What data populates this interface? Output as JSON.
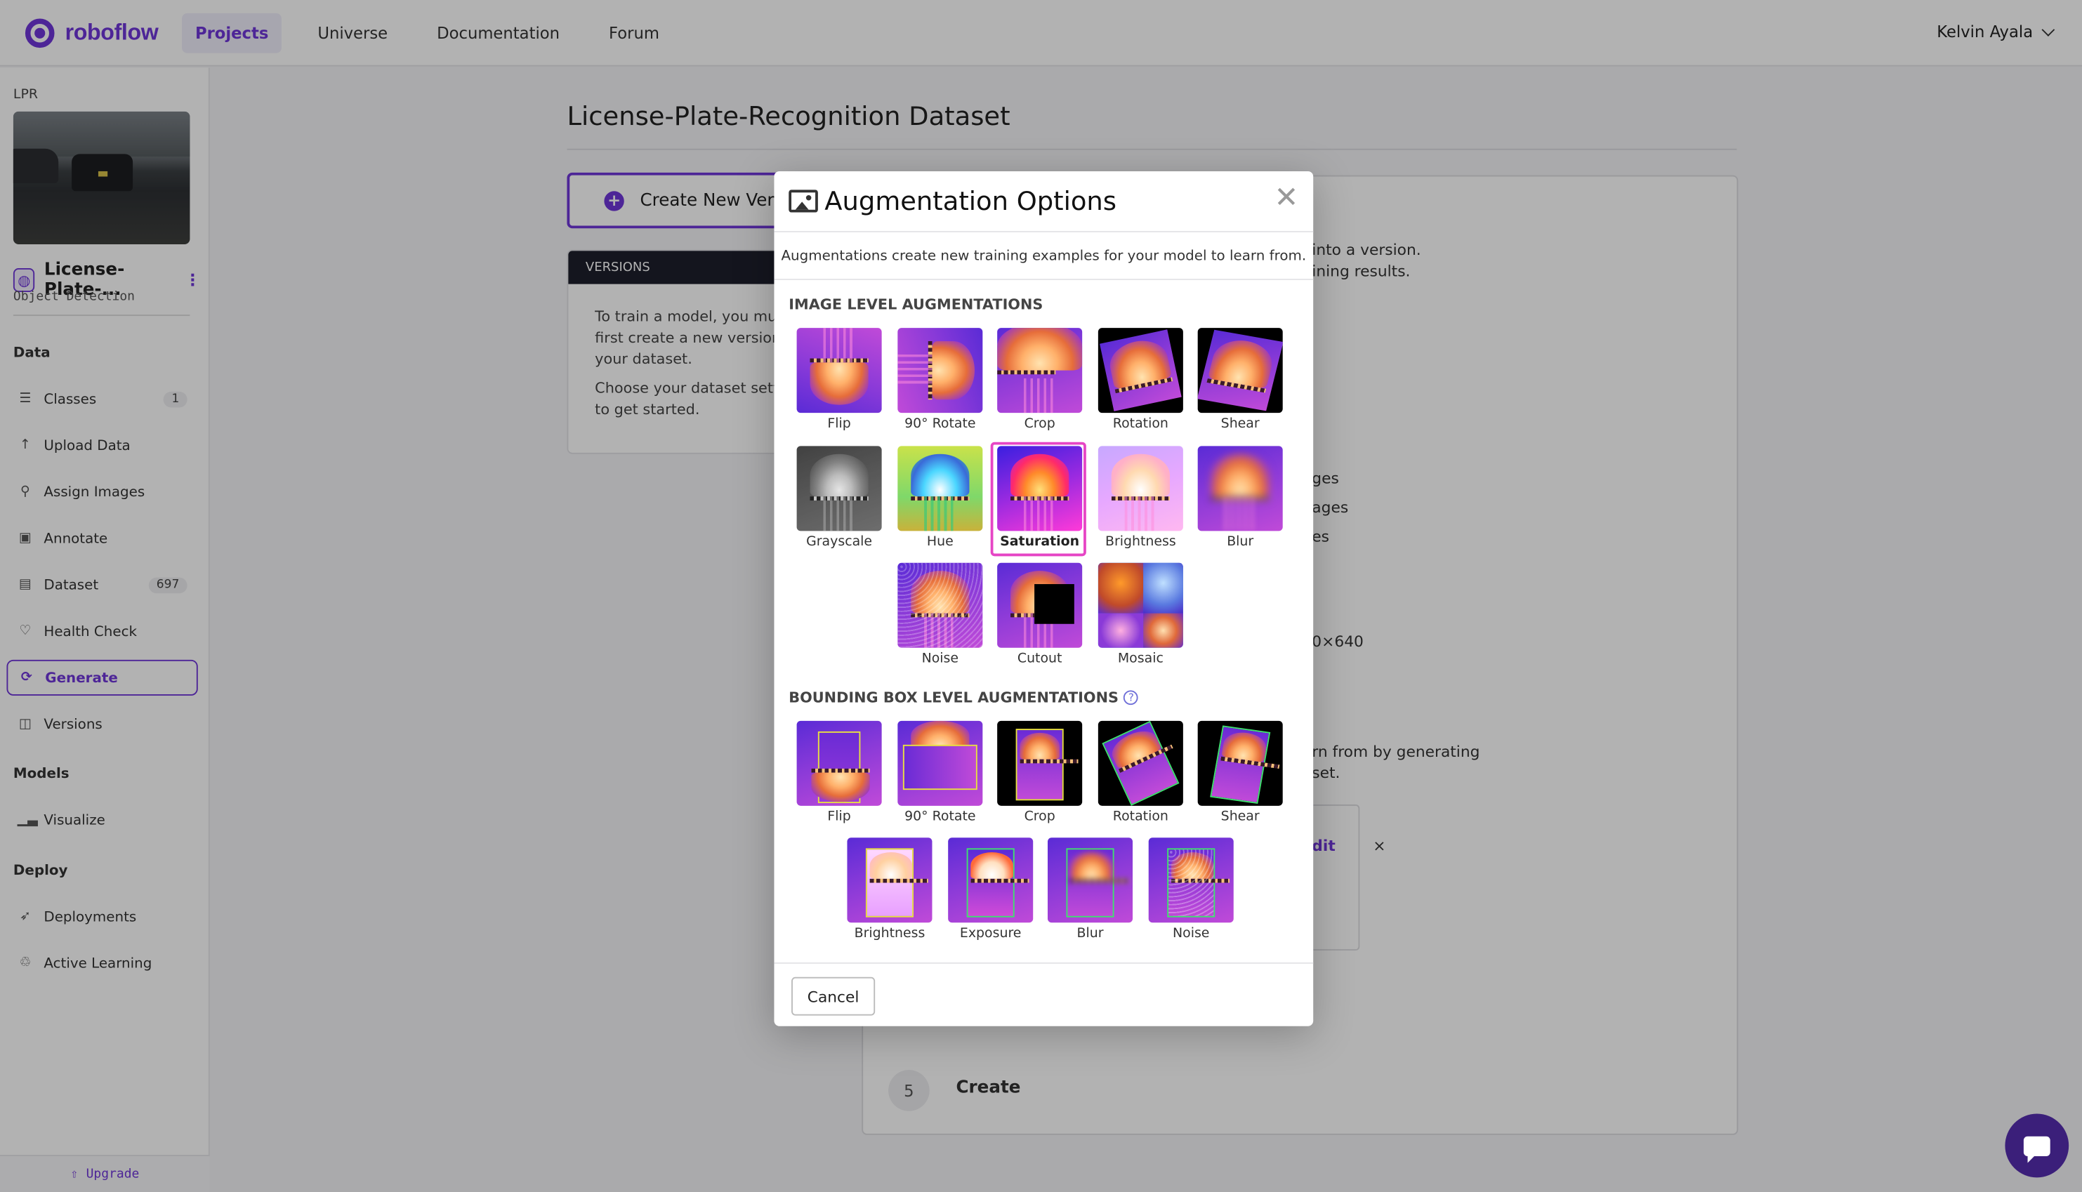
{
  "brand": {
    "name": "roboflow",
    "accent": "#6f36d8"
  },
  "nav": [
    "Projects",
    "Universe",
    "Documentation",
    "Forum"
  ],
  "user": {
    "name": "Kelvin Ayala"
  },
  "sidebar": {
    "project_tag": "LPR",
    "project_name": "License-Plate-...",
    "project_type": "Object Detection",
    "sections": {
      "data": "Data",
      "models": "Models",
      "deploy": "Deploy"
    },
    "items": [
      {
        "label": "Classes",
        "icon": "list-icon",
        "badge": "1"
      },
      {
        "label": "Upload Data",
        "icon": "upload-icon"
      },
      {
        "label": "Assign Images",
        "icon": "search-icon"
      },
      {
        "label": "Annotate",
        "icon": "annotate-icon"
      },
      {
        "label": "Dataset",
        "icon": "dataset-icon",
        "badge": "697"
      },
      {
        "label": "Health Check",
        "icon": "heart-icon"
      },
      {
        "label": "Generate",
        "icon": "generate-icon"
      },
      {
        "label": "Versions",
        "icon": "versions-icon"
      },
      {
        "label": "Visualize",
        "icon": "chart-icon"
      },
      {
        "label": "Deployments",
        "icon": "rocket-icon"
      },
      {
        "label": "Active Learning",
        "icon": "recycle-icon"
      }
    ],
    "upgrade": "Upgrade"
  },
  "main": {
    "title": "License-Plate-Recognition Dataset",
    "create_button": "Create New Vers",
    "versions_header": "VERSIONS",
    "versions_p1_l1": "To train a model, you mus",
    "versions_p1_l2": "first create a new version",
    "versions_p1_l3": "your dataset.",
    "versions_p2_l1": "Choose your dataset setti",
    "versions_p2_l2": "to get started.",
    "right_texts": [
      "into a version.",
      "ining results.",
      "ges",
      "ages",
      "es",
      "0×640",
      "rn from by generating",
      "set.",
      "dit",
      "×"
    ],
    "step_number": "5",
    "step_label": "Create"
  },
  "modal": {
    "title": "Augmentation Options",
    "close": "✕",
    "description": "Augmentations create new training examples for your model to learn from.",
    "image_level_title": "IMAGE LEVEL AUGMENTATIONS",
    "image_level": [
      "Flip",
      "90° Rotate",
      "Crop",
      "Rotation",
      "Shear",
      "Grayscale",
      "Hue",
      "Saturation",
      "Brightness",
      "Blur",
      "Noise",
      "Cutout",
      "Mosaic"
    ],
    "bbox_level_title": "BOUNDING BOX LEVEL AUGMENTATIONS",
    "bbox_level": [
      "Flip",
      "90° Rotate",
      "Crop",
      "Rotation",
      "Shear",
      "Brightness",
      "Exposure",
      "Blur",
      "Noise"
    ],
    "selected": "Saturation",
    "cancel": "Cancel"
  }
}
